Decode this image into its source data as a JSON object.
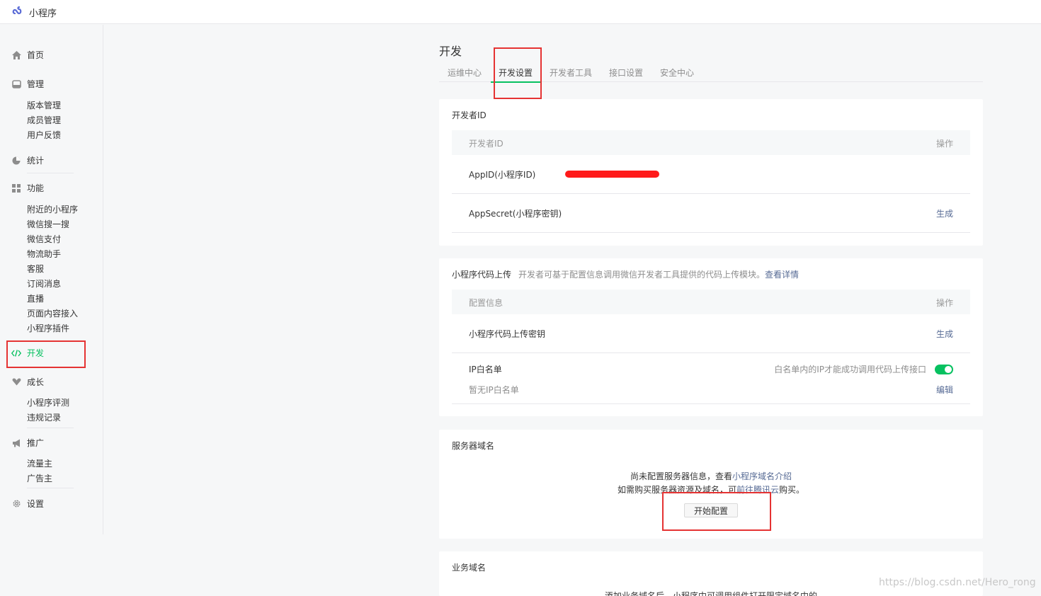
{
  "header": {
    "app_title": "小程序",
    "logo_icon": "wechat-miniprogram-logo-icon"
  },
  "sidebar": {
    "home": "首页",
    "manage": {
      "label": "管理",
      "items": [
        "版本管理",
        "成员管理",
        "用户反馈"
      ]
    },
    "stats": "统计",
    "features": {
      "label": "功能",
      "items": [
        "附近的小程序",
        "微信搜一搜",
        "微信支付",
        "物流助手",
        "客服",
        "订阅消息",
        "直播",
        "页面内容接入",
        "小程序插件"
      ]
    },
    "develop": "开发",
    "growth": {
      "label": "成长",
      "items": [
        "小程序评测",
        "违规记录"
      ]
    },
    "promote": {
      "label": "推广",
      "items": [
        "流量主",
        "广告主"
      ]
    },
    "settings": "设置"
  },
  "page": {
    "title": "开发",
    "tabs": [
      "运维中心",
      "开发设置",
      "开发者工具",
      "接口设置",
      "安全中心"
    ],
    "active_tab": "开发设置"
  },
  "developer_id": {
    "title": "开发者ID",
    "col_name": "开发者ID",
    "col_action": "操作",
    "appid_label": "AppID(小程序ID)",
    "appsecret_label": "AppSecret(小程序密钥)",
    "appsecret_action": "生成"
  },
  "code_upload": {
    "title": "小程序代码上传",
    "desc": "开发者可基于配置信息调用微信开发者工具提供的代码上传模块。",
    "desc_link": "查看详情",
    "col_name": "配置信息",
    "col_action": "操作",
    "key_label": "小程序代码上传密钥",
    "key_action": "生成",
    "ip_label": "IP白名单",
    "ip_hint": "白名单内的IP才能成功调用代码上传接口",
    "ip_empty": "暂无IP白名单",
    "ip_action": "编辑",
    "ip_toggle_on": true
  },
  "server_domain": {
    "title": "服务器域名",
    "line1_prefix": "尚未配置服务器信息，查看",
    "line1_link": "小程序域名介绍",
    "line2_prefix": "如需购买服务器资源及域名，可",
    "line2_link": "前往腾讯云",
    "line2_suffix": "购买。",
    "button": "开始配置"
  },
  "business_domain": {
    "title": "业务域名",
    "partial_text": "添加业务域名后，小程序中可调用组件打开限定域名中的"
  },
  "watermark": "https://blog.csdn.net/Hero_rong",
  "colors": {
    "accent": "#07c160",
    "link": "#576b95",
    "highlight": "#e53333"
  }
}
